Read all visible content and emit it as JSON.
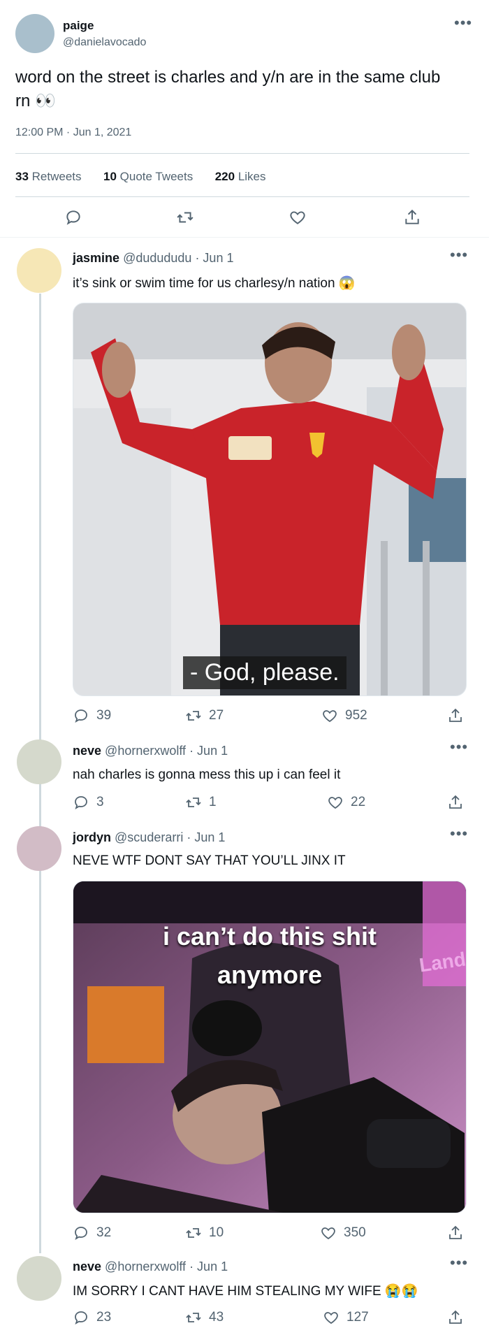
{
  "main_tweet": {
    "display_name": "paige",
    "handle": "@danielavocado",
    "text": "word on the street is charles and y/n are in the same club rn 👀",
    "timestamp": "12:00 PM · Jun 1, 2021",
    "stats": {
      "retweets_count": "33",
      "retweets_label": "Retweets",
      "quotes_count": "10",
      "quotes_label": "Quote Tweets",
      "likes_count": "220",
      "likes_label": "Likes"
    }
  },
  "replies": [
    {
      "display_name": "jasmine",
      "handle": "@dudududu",
      "date": "· Jun 1",
      "text": "it’s sink or swim time for us charlesy/n nation 😱",
      "media_caption": "- God, please.",
      "replies": "39",
      "retweets": "27",
      "likes": "952"
    },
    {
      "display_name": "neve",
      "handle": "@hornerxwolff",
      "date": "· Jun 1",
      "text": "nah charles is gonna mess this up i can feel it",
      "replies": "3",
      "retweets": "1",
      "likes": "22"
    },
    {
      "display_name": "jordyn",
      "handle": "@scuderarri",
      "date": "· Jun 1",
      "text": "NEVE WTF DONT SAY THAT YOU’LL JINX IT",
      "media_caption_line1": "i can’t do this shit",
      "media_caption_line2": "anymore",
      "media_sign": "Land",
      "replies": "32",
      "retweets": "10",
      "likes": "350"
    },
    {
      "display_name": "neve",
      "handle": "@hornerxwolff",
      "date": "· Jun 1",
      "text": "IM SORRY I CANT HAVE HIM STEALING MY WIFE 😭😭",
      "replies": "23",
      "retweets": "43",
      "likes": "127"
    }
  ],
  "icons": {
    "more": "•••",
    "reply": "reply-icon",
    "retweet": "retweet-icon",
    "like": "heart-icon",
    "share": "share-icon"
  },
  "colors": {
    "avatar_paige": "#a9bfcc",
    "avatar_jasmine": "#f6e7b6",
    "avatar_neve": "#d5d9cc",
    "avatar_jordyn": "#d2bcc6",
    "thread_line": "#cfd9de",
    "muted": "#536471"
  }
}
